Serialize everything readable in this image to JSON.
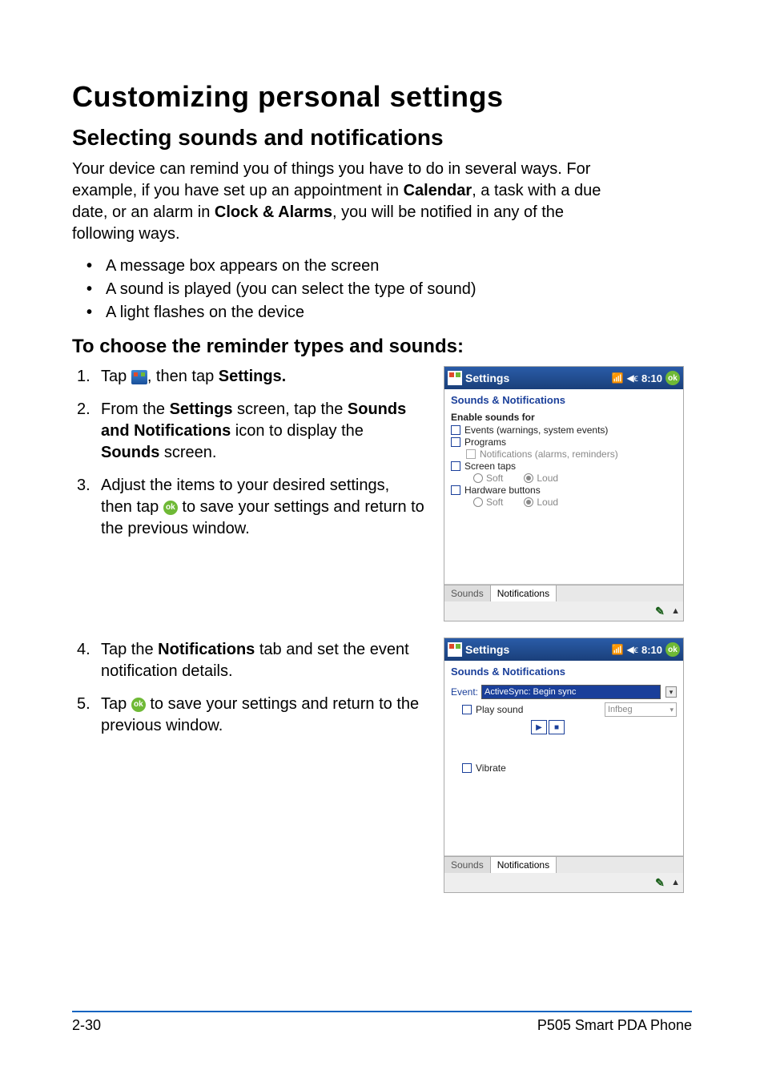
{
  "heading_main": "Customizing personal settings",
  "subheading_selecting": "Selecting sounds and notifications",
  "intro": {
    "pre": "Your device can remind you of things you have to do in several ways. For example, if you have set up an appointment in ",
    "calendar": "Calendar",
    "mid": ", a task with a due date, or an alarm in ",
    "clock": "Clock & Alarms",
    "post": ", you will be notified in any of the following ways."
  },
  "bullets": [
    "A message box appears on the screen",
    "A sound is played (you can select the type of sound)",
    "A light flashes on the device"
  ],
  "subheading_choose": "To choose the reminder types and sounds:",
  "steps_group_a": {
    "s1": {
      "pre": "Tap ",
      "post": ", then tap ",
      "settings": "Settings."
    },
    "s2": {
      "pre": "From the ",
      "settings": "Settings",
      "mid": " screen, tap the ",
      "sounds": "Sounds and Notifications",
      "mid2": " icon to display the ",
      "soundonly": "Sounds",
      "post": " screen."
    },
    "s3": {
      "pre": "Adjust the items to your desired settings, then tap ",
      "post": " to save your settings and return to the previous window."
    }
  },
  "steps_group_b": {
    "s4": {
      "pre": "Tap the ",
      "notif": "Notifications",
      "post": " tab and set the event notification details."
    },
    "s5": {
      "pre": "Tap ",
      "post": " to save your settings and return to the previous window."
    }
  },
  "pda": {
    "titlebar_label": "Settings",
    "clock": "8:10",
    "ok": "ok",
    "subtitle": "Sounds & Notifications",
    "screen1": {
      "enable_label": "Enable sounds for",
      "items": {
        "events": "Events (warnings, system events)",
        "programs": "Programs",
        "notifications": "Notifications (alarms, reminders)",
        "screentaps": "Screen taps",
        "hardware": "Hardware buttons"
      },
      "soft": "Soft",
      "loud": "Loud",
      "tab_sounds": "Sounds",
      "tab_notifications": "Notifications"
    },
    "screen2": {
      "event_label": "Event:",
      "event_value": "ActiveSync: Begin sync",
      "play_sound": "Play sound",
      "sound_name": "Infbeg",
      "vibrate": "Vibrate",
      "tab_sounds": "Sounds",
      "tab_notifications": "Notifications"
    }
  },
  "footer": {
    "left": "2-30",
    "right": "P505 Smart PDA Phone"
  }
}
